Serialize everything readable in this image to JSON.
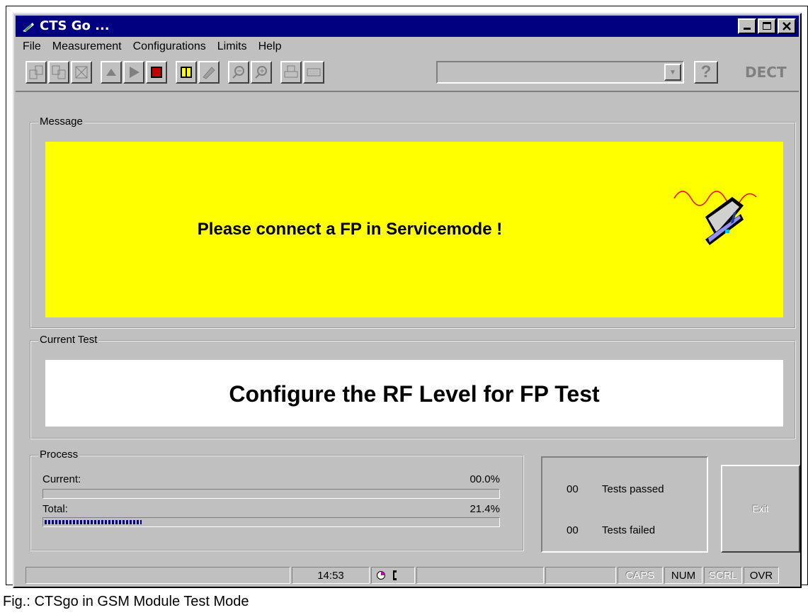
{
  "window": {
    "title": "CTS Go ..."
  },
  "menu": [
    "File",
    "Measurement",
    "Configurations",
    "Limits",
    "Help"
  ],
  "toolbar": {
    "buttons": [
      "load-icon",
      "save-icon",
      "delete-icon",
      "step-icon",
      "play-icon",
      "stop-icon",
      "pause-icon",
      "settings-icon",
      "zoom-out-icon",
      "zoom-in-icon",
      "print-icon",
      "keyboard-icon"
    ],
    "combo_value": "",
    "help_label": "?",
    "mode_label": "DECT"
  },
  "message": {
    "group_label": "Message",
    "text": "Please connect a FP in Servicemode !",
    "background": "#ffff00"
  },
  "current_test": {
    "group_label": "Current Test",
    "text": "Configure the RF Level for FP Test"
  },
  "process": {
    "group_label": "Process",
    "current_label": "Current:",
    "current_value": "00.0%",
    "current_fraction": 0.0,
    "total_label": "Total:",
    "total_value": "21.4%",
    "total_fraction": 0.214
  },
  "results": {
    "passed_count": "00",
    "passed_label": "Tests passed",
    "failed_count": "00",
    "failed_label": "Tests failed"
  },
  "exit_button": {
    "label": "Exit"
  },
  "statusbar": {
    "time": "14:53",
    "caps": "CAPS",
    "num": "NUM",
    "scrl": "SCRL",
    "ovr": "OVR"
  },
  "caption": "Fig.: CTSgo in GSM Module Test Mode"
}
